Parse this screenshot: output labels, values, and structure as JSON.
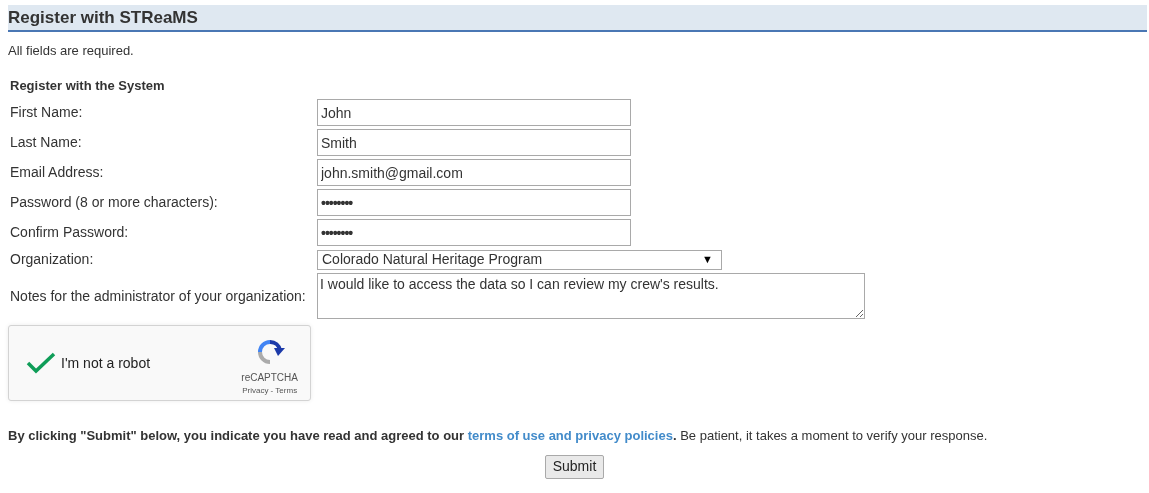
{
  "header": {
    "title": "Register with STReaMS"
  },
  "intro": "All fields are required.",
  "section_title": "Register with the System",
  "fields": [
    {
      "kind": "text",
      "label": "First Name:",
      "value": "John"
    },
    {
      "kind": "text",
      "label": "Last Name:",
      "value": "Smith"
    },
    {
      "kind": "text",
      "label": "Email Address:",
      "value": "john.smith@gmail.com"
    },
    {
      "kind": "password",
      "label": "Password (8 or more characters):",
      "value": "••••••••"
    },
    {
      "kind": "password",
      "label": "Confirm Password:",
      "value": "••••••••"
    },
    {
      "kind": "select",
      "label": "Organization:",
      "value": "Colorado Natural Heritage Program",
      "arrow": "▼"
    },
    {
      "kind": "textarea",
      "label": "Notes for the administrator of your organization:",
      "value": "I would like to access the data so I can review my crew's results."
    }
  ],
  "captcha": {
    "checked": true,
    "label": "I'm not a robot",
    "brand": "reCAPTCHA",
    "privacy": "Privacy",
    "separator": " - ",
    "terms": "Terms"
  },
  "consent": {
    "before": "By clicking \"Submit\" below, you indicate you have read and agreed to our ",
    "link": "terms of use and privacy policies",
    "after": "**.** Be patient, it takes a moment to verify your response."
  },
  "submit": "Submit"
}
